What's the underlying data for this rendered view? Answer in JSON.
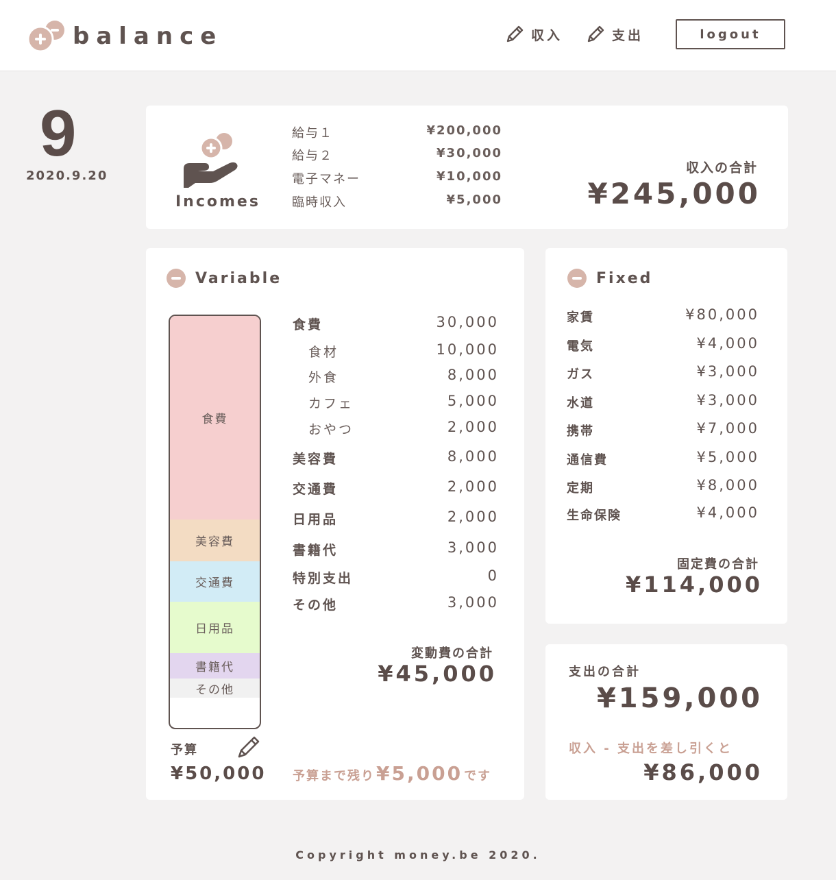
{
  "header": {
    "logo_text": "balance",
    "nav": {
      "income_label": "収入",
      "expense_label": "支出"
    },
    "logout_label": "logout"
  },
  "date": {
    "day": "9",
    "full": "2020.9.20"
  },
  "incomes": {
    "label": "Incomes",
    "items": [
      {
        "name": "給与１",
        "value": "¥200,000"
      },
      {
        "name": "給与２",
        "value": "¥30,000"
      },
      {
        "name": "電子マネー",
        "value": "¥10,000"
      },
      {
        "name": "臨時収入",
        "value": "¥5,000"
      }
    ],
    "total_label": "収入の合計",
    "total_value": "¥245,000"
  },
  "variable": {
    "title": "Variable",
    "bar_segments": [
      {
        "label": "食費",
        "color": "#f6cfcf"
      },
      {
        "label": "美容費",
        "color": "#f3dcc3"
      },
      {
        "label": "交通費",
        "color": "#d2ecf6"
      },
      {
        "label": "日用品",
        "color": "#e6fbcd"
      },
      {
        "label": "書籍代",
        "color": "#e3d6ef"
      },
      {
        "label": "その他",
        "color": "#f1f1f1"
      }
    ],
    "items": [
      {
        "name": "食費",
        "value": "30,000"
      },
      {
        "name": "食材",
        "value": "10,000",
        "sub": true
      },
      {
        "name": "外食",
        "value": "8,000",
        "sub": true
      },
      {
        "name": "カフェ",
        "value": "5,000",
        "sub": true
      },
      {
        "name": "おやつ",
        "value": "2,000",
        "sub": true
      },
      {
        "name": "美容費",
        "value": "8,000"
      },
      {
        "name": "交通費",
        "value": "2,000"
      },
      {
        "name": "日用品",
        "value": "2,000"
      },
      {
        "name": "書籍代",
        "value": "3,000"
      },
      {
        "name": "特別支出",
        "value": "0"
      },
      {
        "name": "その他",
        "value": "3,000"
      }
    ],
    "total_label": "変動費の合計",
    "total_value": "¥45,000",
    "budget_label": "予算",
    "budget_value": "¥50,000",
    "remaining_prefix": "予算まで残り",
    "remaining_value": "¥5,000",
    "remaining_suffix": "です"
  },
  "fixed": {
    "title": "Fixed",
    "items": [
      {
        "name": "家賃",
        "value": "¥80,000"
      },
      {
        "name": "電気",
        "value": "¥4,000"
      },
      {
        "name": "ガス",
        "value": "¥3,000"
      },
      {
        "name": "水道",
        "value": "¥3,000"
      },
      {
        "name": "携帯",
        "value": "¥7,000"
      },
      {
        "name": "通信費",
        "value": "¥5,000"
      },
      {
        "name": "定期",
        "value": "¥8,000"
      },
      {
        "name": "生命保険",
        "value": "¥4,000"
      }
    ],
    "total_label": "固定費の合計",
    "total_value": "¥114,000"
  },
  "summary": {
    "expense_total_label": "支出の合計",
    "expense_total_value": "¥159,000",
    "diff_label": "収入 - 支出を差し引くと",
    "diff_value": "¥86,000"
  },
  "colors": {
    "accent": "#d6b5aa",
    "text": "#5f5350",
    "highlight": "#c9a093"
  },
  "footer": {
    "copyright": "Copyright money.be 2020."
  }
}
